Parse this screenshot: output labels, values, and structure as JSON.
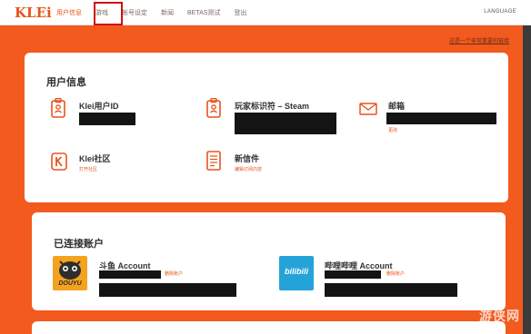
{
  "nav": {
    "logo": "KLEi",
    "items": [
      "用户信息",
      "游戏",
      "帐号设定",
      "新闻",
      "BETAS测试",
      "登出"
    ],
    "language": "LANGUAGE"
  },
  "helper_link": "这是一个非常重要的链接",
  "user_info": {
    "title": "用户信息",
    "klei_id": {
      "label": "Klei用户ID",
      "icon": "id-badge-icon"
    },
    "player_id": {
      "label": "玩家标识符 – Steam",
      "icon": "id-badge-icon"
    },
    "email": {
      "label": "邮箱",
      "link": "更改",
      "icon": "envelope-icon"
    },
    "community": {
      "label": "Klei社区",
      "link": "打开社区",
      "icon": "klei-k-icon"
    },
    "newsletter": {
      "label": "新信件",
      "link": "编辑订阅内容",
      "icon": "document-icon"
    }
  },
  "linked_accounts": {
    "title": "已连接账户",
    "douyu": {
      "label": "斗鱼 Account",
      "link": "删除账户",
      "logo_text": "DOUYU"
    },
    "bilibili": {
      "label": "哔哩哔哩 Account",
      "link": "删除账户",
      "logo_text": "bilibili"
    }
  },
  "watermark": "游侠网",
  "colors": {
    "accent": "#e8531b",
    "background": "#f25a1e",
    "highlight_box": "#d01010"
  }
}
